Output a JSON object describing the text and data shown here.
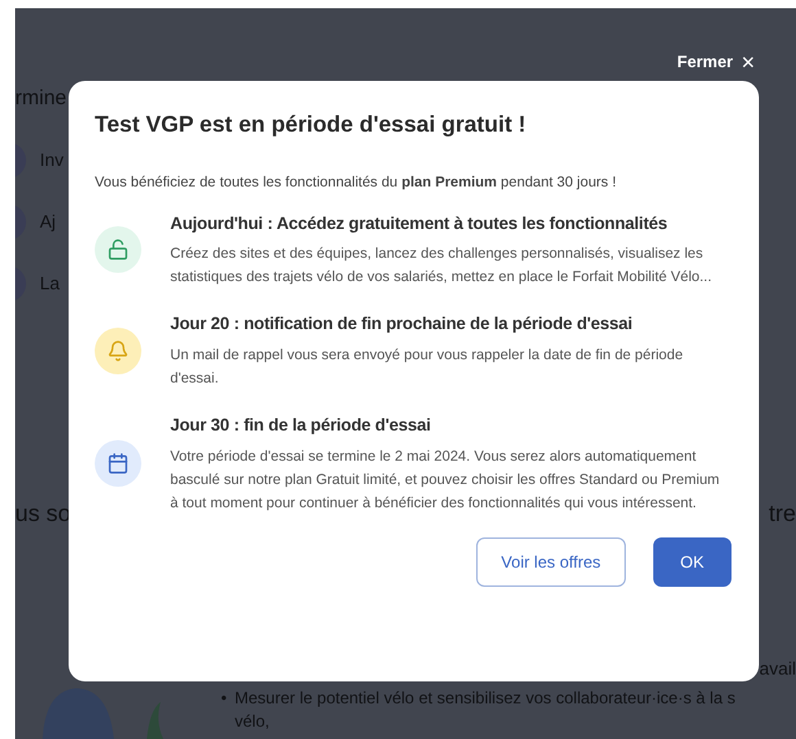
{
  "background": {
    "heading_fragment": "rmine",
    "items": [
      {
        "label": "Inv"
      },
      {
        "label": "Aj"
      },
      {
        "label": "La"
      }
    ],
    "section_fragment_left": "us so",
    "section_fragment_right": "tre",
    "line_fragment": "avail",
    "bullet_marker": "•",
    "bullet": "Mesurer le potentiel vélo et sensibilisez vos collaborateur·ice·s à la s",
    "bullet_continuation": "vélo,"
  },
  "close_button": {
    "label": "Fermer",
    "glyph": "×"
  },
  "modal": {
    "title": "Test VGP est en période d'essai gratuit !",
    "intro": "Vous bénéficiez de toutes les fonctionnalités du **plan Premium** pendant 30 jours !",
    "steps": [
      {
        "kind": "unlock",
        "color": "#e3f6ec",
        "title": "Aujourd'hui : Accédez gratuitement à toutes les fonctionnalités",
        "text": "Créez des sites et des équipes, lancez des challenges personnalisés, visualisez les statistiques des trajets vélo de vos salariés, mettez en place le Forfait Mobilité Vélo..."
      },
      {
        "kind": "bell",
        "color": "#fdefb8",
        "title": "Jour 20 : notification de fin prochaine de la période d'essai",
        "text": "Un mail de rappel vous sera envoyé pour vous rappeler la date de fin de période d'essai."
      },
      {
        "kind": "calendar",
        "color": "#e1ebfc",
        "title": "Jour 30 : fin de la période d'essai",
        "text": "Votre période d'essai se termine le 2 mai 2024. Vous serez alors automatiquement basculé sur notre plan Gratuit limité, et pouvez choisir les offres Standard ou Premium à tout moment pour continuer à bénéficier des fonctionnalités qui vous intéressent."
      }
    ],
    "buttons": [
      {
        "kind": "secondary",
        "label": "Voir les offres"
      },
      {
        "kind": "primary",
        "label": "OK"
      }
    ]
  }
}
